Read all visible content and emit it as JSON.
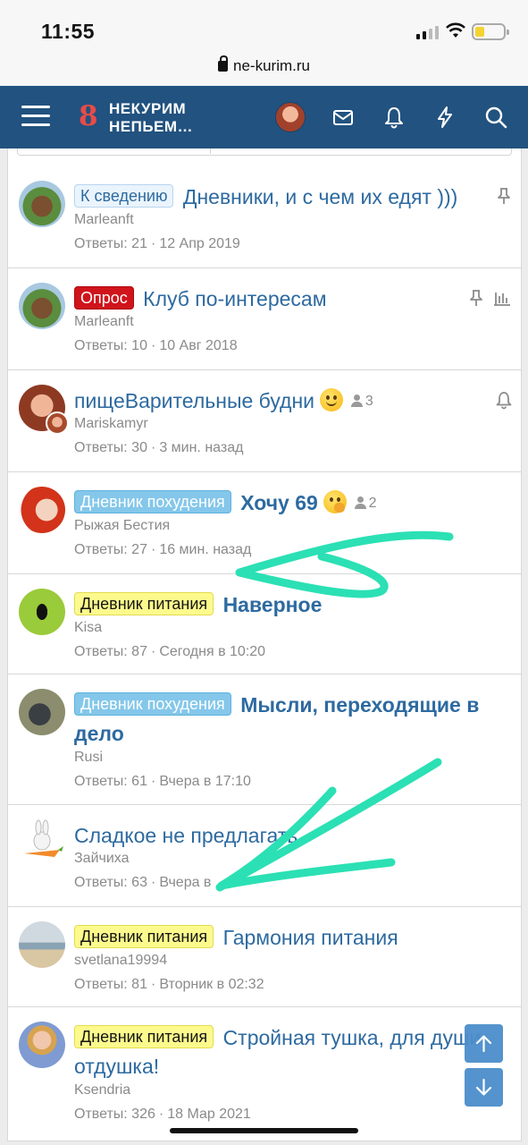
{
  "status_bar": {
    "time": "11:55"
  },
  "browser": {
    "url": "ne-kurim.ru"
  },
  "header": {
    "logo_line1": "НЕКУРИМ",
    "logo_line2": "НЕПЬЕМ…",
    "logo_digit": "8",
    "icons": [
      "menu-icon",
      "avatar",
      "inbox-icon",
      "bell-icon",
      "lightning-icon",
      "search-icon"
    ]
  },
  "threads": [
    {
      "label": "К сведению",
      "label_type": "info",
      "title": "Дневники, и с чем их едят )))",
      "author": "Marleanft",
      "replies": "Ответы: 21",
      "date": "12 Апр 2019",
      "icons": [
        "pin-icon"
      ]
    },
    {
      "label": "Опрос",
      "label_type": "poll",
      "title": "Клуб по-интересам",
      "author": "Marleanft",
      "replies": "Ответы: 10",
      "date": "10 Авг 2018",
      "icons": [
        "pin-icon",
        "poll-chart-icon"
      ]
    },
    {
      "label": "",
      "label_type": "",
      "title": "пищеВарительные будни",
      "emoji": "slight-smile-emoji",
      "participants": "3",
      "author": "Mariskamyr",
      "replies": "Ответы: 30",
      "date": "3 мин. назад",
      "icons": [
        "bell-icon"
      ]
    },
    {
      "label": "Дневник похудения",
      "label_type": "loss",
      "title": "Хочу 69",
      "emoji": "shushing-face-emoji",
      "participants": "2",
      "author": "Рыжая Бестия",
      "replies": "Ответы: 27",
      "date": "16 мин. назад"
    },
    {
      "label": "Дневник питания",
      "label_type": "food",
      "title": "Наверное",
      "author": "Kisa",
      "replies": "Ответы: 87",
      "date": "Сегодня в 10:20"
    },
    {
      "label": "Дневник похудения",
      "label_type": "loss",
      "title": "Мысли, переходящие в дело",
      "author": "Rusi",
      "replies": "Ответы: 61",
      "date": "Вчера в 17:10"
    },
    {
      "label": "",
      "label_type": "",
      "title": "Сладкое не предлагать",
      "author": "Зайчиха",
      "replies": "Ответы: 63",
      "date": "Вчера в"
    },
    {
      "label": "Дневник питания",
      "label_type": "food",
      "title": "Гармония питания",
      "author": "svetlana19994",
      "replies": "Ответы: 81",
      "date": "Вторник в 02:32"
    },
    {
      "label": "Дневник питания",
      "label_type": "food",
      "title": "Стройная тушка, для души отдушка!",
      "author": "Ksendria",
      "replies": "Ответы: 326",
      "date": "18 Мар 2021"
    }
  ],
  "meta_separator": "·",
  "floating": [
    "scroll-up-button",
    "scroll-down-button"
  ],
  "colors": {
    "header_bg": "#22527f",
    "link": "#2d6aa0",
    "annotation_arrows": "#2be0b4"
  }
}
